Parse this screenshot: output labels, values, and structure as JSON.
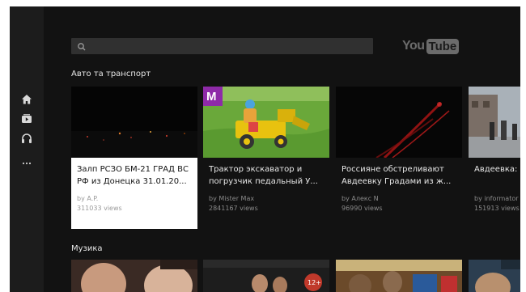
{
  "app": {
    "logo_you": "You",
    "logo_tube": "Tube"
  },
  "search": {
    "placeholder": "",
    "value": ""
  },
  "sidebar": {
    "items": [
      {
        "icon": "home-icon"
      },
      {
        "icon": "subscriptions-icon"
      },
      {
        "icon": "headphones-icon"
      },
      {
        "icon": "more-icon"
      }
    ]
  },
  "sections": [
    {
      "title": "Авто та транспорт",
      "videos": [
        {
          "title": "Залп РСЗО БМ-21 ГРАД ВС РФ из Донецка 31.01.20...",
          "author": "by A.P.",
          "views": "311033 views"
        },
        {
          "title": "Трактор экскаватор и погрузчик педальный У...",
          "author": "by Mister Max",
          "views": "2841167 views",
          "badge": "M"
        },
        {
          "title": "Россияне обстреливают Авдеевку Градами из ж...",
          "author": "by Алекс N",
          "views": "96990 views"
        },
        {
          "title": "Авдеевка: как в четы",
          "author": "by informator",
          "views": "151913 views"
        }
      ]
    },
    {
      "title": "Музика",
      "videos": [
        {
          "title": ""
        },
        {
          "title": "",
          "badge": "12+"
        },
        {
          "title": ""
        },
        {
          "title": ""
        }
      ]
    }
  ]
}
